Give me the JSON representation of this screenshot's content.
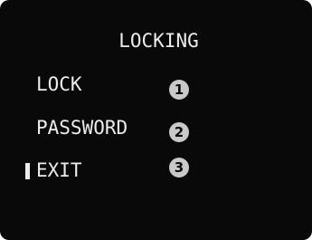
{
  "osd": {
    "title": "LOCKING",
    "items": [
      {
        "label": "LOCK",
        "badge": "1"
      },
      {
        "label": "PASSWORD",
        "badge": "2"
      },
      {
        "label": "EXIT",
        "badge": "3"
      }
    ],
    "selected_item": "EXIT",
    "colors": {
      "background": "#090909",
      "text": "#ececec",
      "badge_fill": "#c9c9c9",
      "badge_text": "#0b0b0b"
    }
  }
}
